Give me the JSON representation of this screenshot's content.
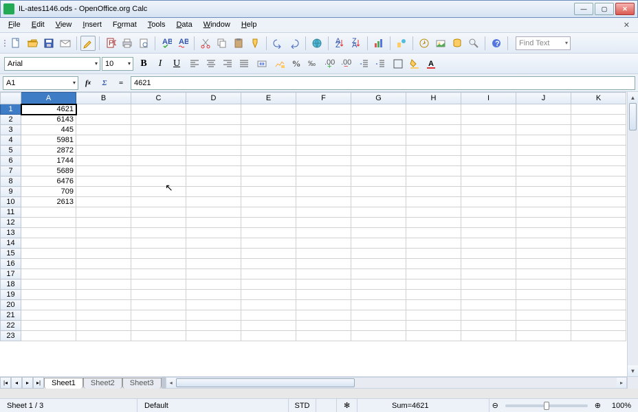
{
  "window": {
    "title": "IL-ates1146.ods - OpenOffice.org Calc"
  },
  "menus": [
    "File",
    "Edit",
    "View",
    "Insert",
    "Format",
    "Tools",
    "Data",
    "Window",
    "Help"
  ],
  "find_placeholder": "Find Text",
  "format": {
    "font_name": "Arial",
    "font_size": "10"
  },
  "formula": {
    "cell_ref": "A1",
    "value": "4621"
  },
  "columns": [
    "A",
    "B",
    "C",
    "D",
    "E",
    "F",
    "G",
    "H",
    "I",
    "J",
    "K"
  ],
  "rows": [
    1,
    2,
    3,
    4,
    5,
    6,
    7,
    8,
    9,
    10,
    11,
    12,
    13,
    14,
    15,
    16,
    17,
    18,
    19,
    20,
    21,
    22,
    23
  ],
  "cells": {
    "A1": "4621",
    "A2": "6143",
    "A3": "445",
    "A4": "5981",
    "A5": "2872",
    "A6": "1744",
    "A7": "5689",
    "A8": "6476",
    "A9": "709",
    "A10": "2613"
  },
  "selected_cell": "A1",
  "sheets": [
    "Sheet1",
    "Sheet2",
    "Sheet3"
  ],
  "active_sheet": 0,
  "status": {
    "sheet": "Sheet 1 / 3",
    "style": "Default",
    "mode": "STD",
    "sum": "Sum=4621",
    "zoom": "100%"
  },
  "zoom_symbols": {
    "minus": "⊖",
    "plus": "⊕"
  }
}
